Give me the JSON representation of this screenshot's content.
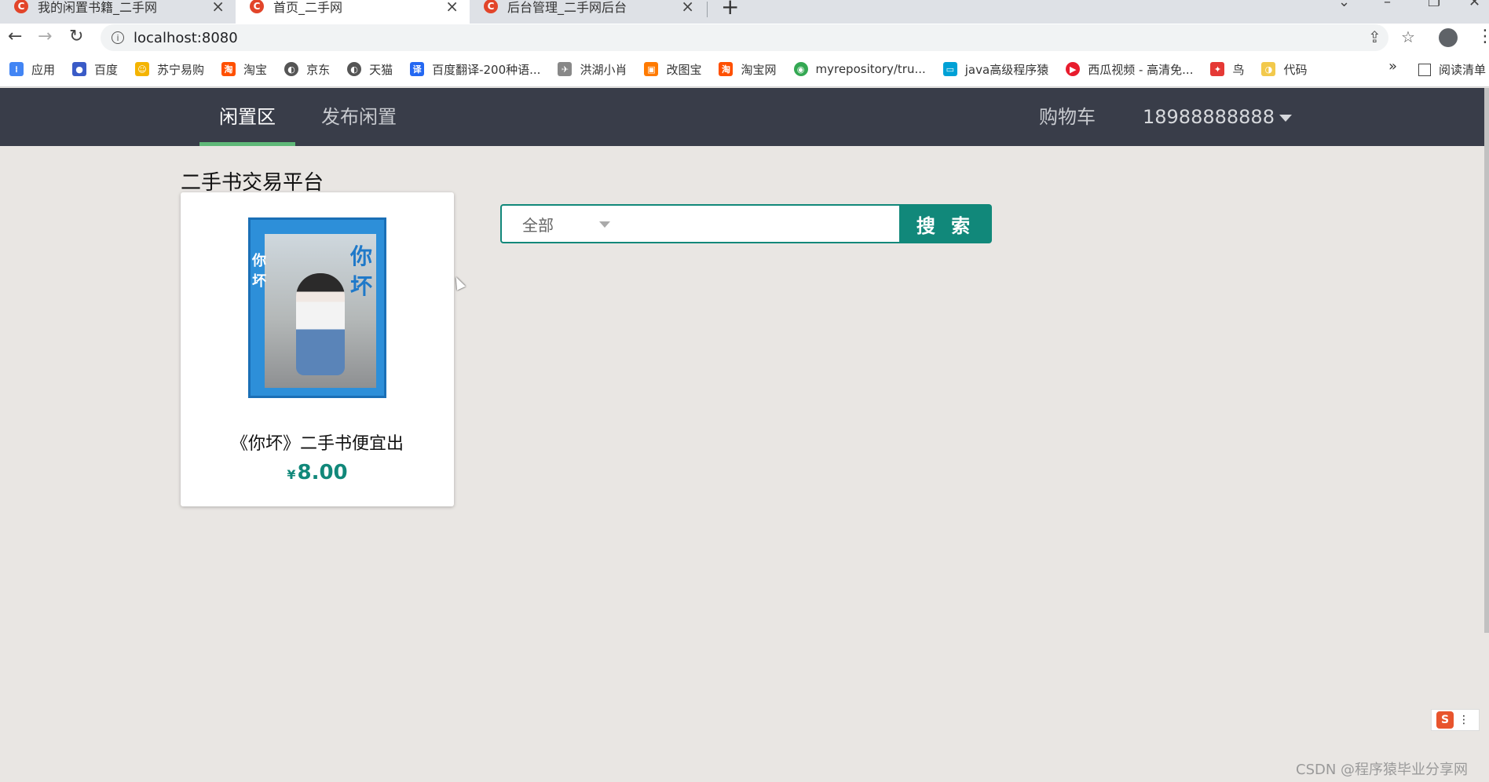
{
  "browser": {
    "tabs": [
      {
        "title": "我的闲置书籍_二手网",
        "favicon": "C"
      },
      {
        "title": "首页_二手网",
        "favicon": "C"
      },
      {
        "title": "后台管理_二手网后台",
        "favicon": "C"
      }
    ],
    "url": "localhost:8080",
    "bookmarks": [
      {
        "label": "应用",
        "color": "#4285f4"
      },
      {
        "label": "百度",
        "color": "#3a5bc7"
      },
      {
        "label": "苏宁易购",
        "color": "#f4b400"
      },
      {
        "label": "淘宝",
        "color": "#ff5000"
      },
      {
        "label": "京东",
        "color": "#555555"
      },
      {
        "label": "天猫",
        "color": "#555555"
      },
      {
        "label": "百度翻译-200种语...",
        "color": "#2468f2"
      },
      {
        "label": "洪湖小肖",
        "color": "#888888"
      },
      {
        "label": "改图宝",
        "color": "#ff7a00"
      },
      {
        "label": "淘宝网",
        "color": "#ff5000"
      },
      {
        "label": "myrepository/tru...",
        "color": "#34a853"
      },
      {
        "label": "java高级程序猿",
        "color": "#00a1d6"
      },
      {
        "label": "西瓜视频 - 高清免...",
        "color": "#e81c2d"
      },
      {
        "label": "鸟",
        "color": "#e53935"
      },
      {
        "label": "代码",
        "color": "#f2c94c"
      }
    ],
    "bookmarks_more": "»",
    "reading_list": "阅读清单"
  },
  "nav": {
    "items": [
      "闲置区",
      "发布闲置"
    ],
    "cart": "购物车",
    "user": "18988888888"
  },
  "page": {
    "section_title": "二手书交易平台",
    "search": {
      "category_selected": "全部",
      "input_value": "",
      "button_label": "搜 索"
    },
    "products": [
      {
        "title": "《你坏》二手书便宜出",
        "currency": "¥",
        "price": "8.00",
        "cover_title": "你坏"
      }
    ]
  },
  "ime": {
    "label": "S"
  },
  "watermark": "CSDN @程序猿毕业分享网"
}
